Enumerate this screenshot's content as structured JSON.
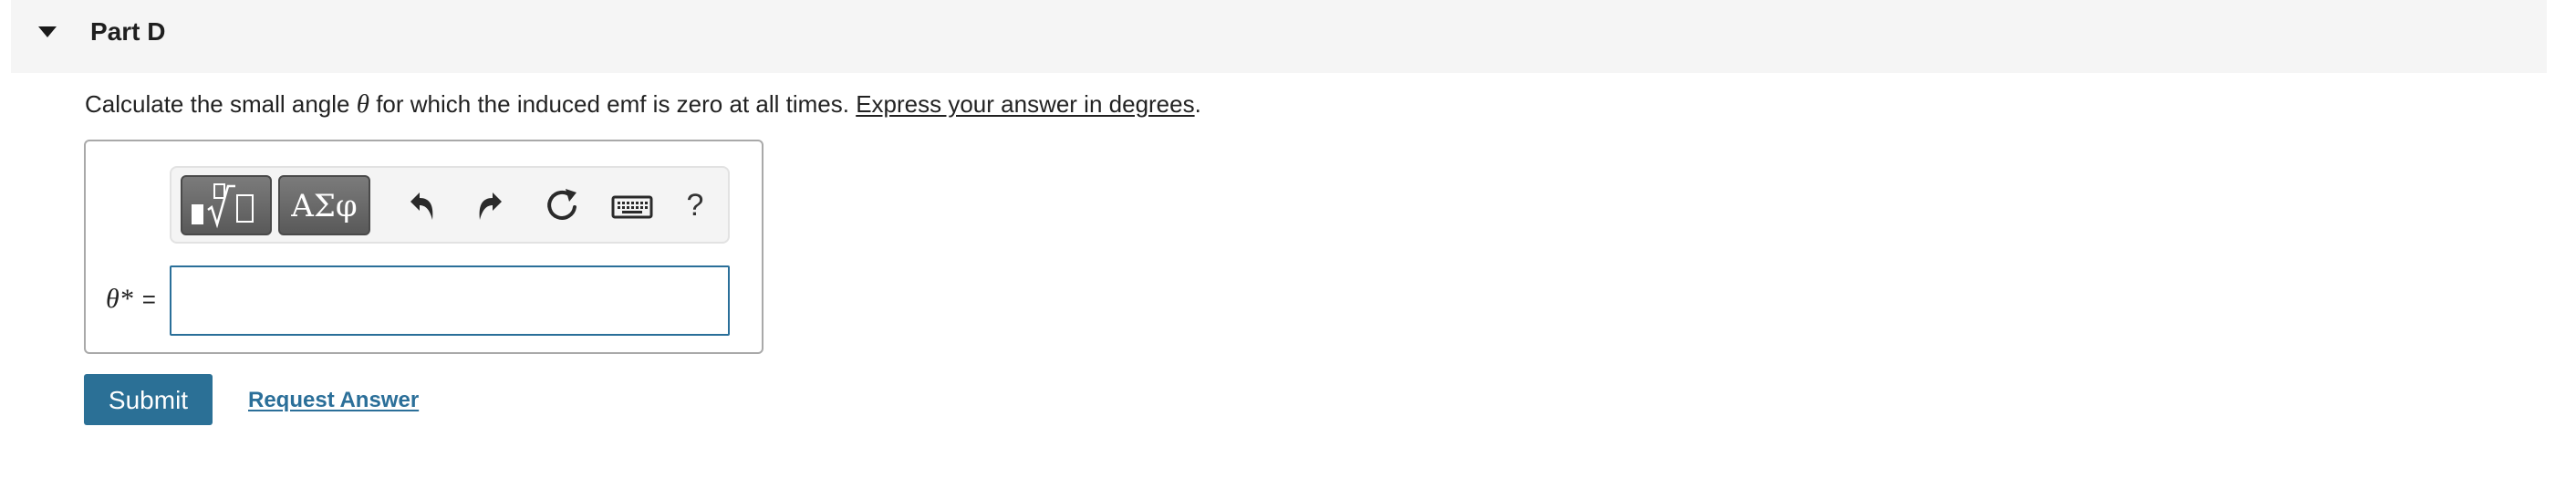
{
  "part": {
    "title": "Part D",
    "expanded": true
  },
  "question": {
    "text_before": "Calculate the small angle ",
    "symbol": "θ",
    "text_after": " for which the induced emf is zero at all times. ",
    "instruction": "Express your answer in degrees",
    "trailing": "."
  },
  "toolbar": {
    "buttons": [
      {
        "name": "templates",
        "icon": "fraction-sqrt-icon"
      },
      {
        "name": "greek-symbols",
        "label": "ΑΣφ"
      },
      {
        "name": "undo",
        "icon": "undo-icon"
      },
      {
        "name": "redo",
        "icon": "redo-icon"
      },
      {
        "name": "reset",
        "icon": "reset-icon"
      },
      {
        "name": "keyboard",
        "icon": "keyboard-icon"
      },
      {
        "name": "help",
        "label": "?"
      }
    ]
  },
  "answer": {
    "variable": "θ*",
    "equals": "=",
    "value": "",
    "placeholder": ""
  },
  "actions": {
    "submit_label": "Submit",
    "request_label": "Request Answer"
  },
  "colors": {
    "accent": "#2b7096",
    "header_bg": "#f5f5f5",
    "input_border": "#2a6f99"
  }
}
